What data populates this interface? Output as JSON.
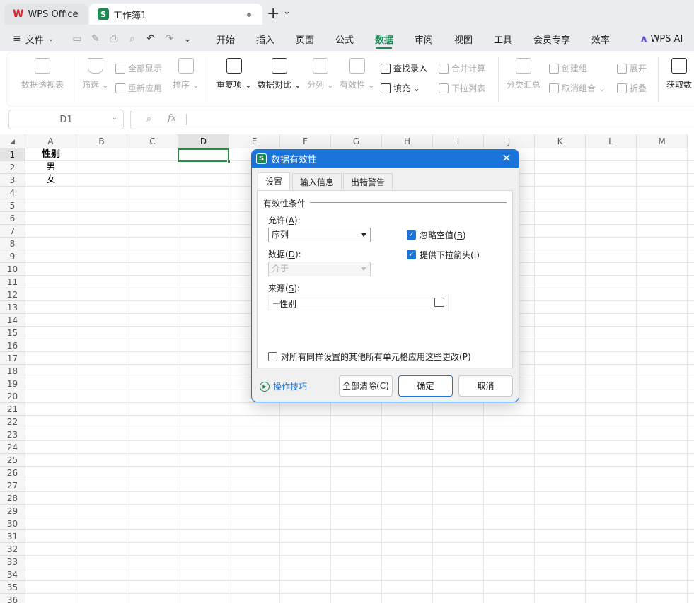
{
  "titlebar": {
    "app_tab": "WPS Office",
    "doc_tab": "工作簿1",
    "new_tab": "+",
    "tab_menu": "⌄"
  },
  "menubar": {
    "file": "文件",
    "items": [
      "开始",
      "插入",
      "页面",
      "公式",
      "数据",
      "审阅",
      "视图",
      "工具",
      "会员专享",
      "效率"
    ],
    "active": "数据",
    "ai": "WPS AI"
  },
  "ribbon": {
    "pivot": "数据透视表",
    "filter": "筛选",
    "show_all": "全部显示",
    "reapply": "重新应用",
    "sort": "排序",
    "duplicates": "重复项",
    "compare": "数据对比",
    "split": "分列",
    "validation": "有效性",
    "lookup_entry": "查找录入",
    "fill": "填充",
    "consolidate": "合并计算",
    "dropdown_list": "下拉列表",
    "subtotal": "分类汇总",
    "group": "创建组",
    "ungroup": "取消组合",
    "expand": "展开",
    "collapse": "折叠",
    "get_data": "获取数"
  },
  "formula_bar": {
    "name_box": "D1",
    "fx": "fx"
  },
  "grid": {
    "columns": [
      "A",
      "B",
      "C",
      "D",
      "E",
      "F",
      "G",
      "H",
      "I",
      "J",
      "K",
      "L",
      "M"
    ],
    "rows": [
      "1",
      "2",
      "3",
      "4",
      "5",
      "6",
      "7",
      "8",
      "9",
      "10",
      "11",
      "12",
      "13",
      "14",
      "15",
      "16",
      "17",
      "18",
      "19",
      "20",
      "21",
      "22",
      "23",
      "24",
      "25",
      "26",
      "27",
      "28",
      "29",
      "30",
      "31",
      "32",
      "33",
      "34",
      "35",
      "36"
    ],
    "cells": {
      "A1": "性别",
      "A2": "男",
      "A3": "女"
    },
    "selected": "D1"
  },
  "dialog": {
    "title": "数据有效性",
    "tabs": [
      "设置",
      "输入信息",
      "出错警告"
    ],
    "active_tab": "设置",
    "section": "有效性条件",
    "allow_label": "允许(",
    "allow_key": "A",
    "allow_value": "序列",
    "data_label": "数据(",
    "data_key": "D",
    "data_value": "介于",
    "source_label": "来源(",
    "source_key": "S",
    "source_value": "=性别",
    "ignore_blank": "忽略空值(",
    "ignore_blank_key": "B",
    "ignore_blank_checked": true,
    "dropdown": "提供下拉箭头(",
    "dropdown_key": "I",
    "dropdown_checked": true,
    "apply_all": "对所有同样设置的其他所有单元格应用这些更改(",
    "apply_all_key": "P",
    "apply_all_checked": false,
    "tips": "操作技巧",
    "clear_all": "全部清除(",
    "clear_all_key": "C",
    "ok": "确定",
    "cancel": "取消",
    "accent": "#1a73d9"
  }
}
